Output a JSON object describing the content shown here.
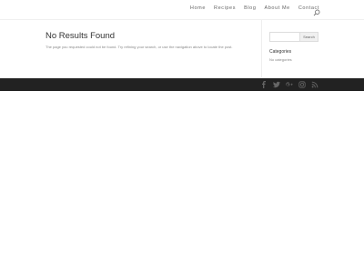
{
  "nav": {
    "items": [
      "Home",
      "Recipes",
      "Blog",
      "About Me",
      "Contact"
    ]
  },
  "icons": {
    "search": "search-icon",
    "social": [
      "facebook-icon",
      "twitter-icon",
      "google-plus-icon",
      "instagram-icon",
      "rss-icon"
    ]
  },
  "main": {
    "title": "No Results Found",
    "message": "The page you requested could not be found. Try refining your search, or use the navigation above to locate the post."
  },
  "sidebar": {
    "search_button": "Search",
    "search_value": "",
    "categories_title": "Categories",
    "categories_empty": "No categories"
  },
  "colors": {
    "footer_bg": "#222222",
    "text": "#666666",
    "title": "#333333",
    "social_icon": "#666666"
  }
}
